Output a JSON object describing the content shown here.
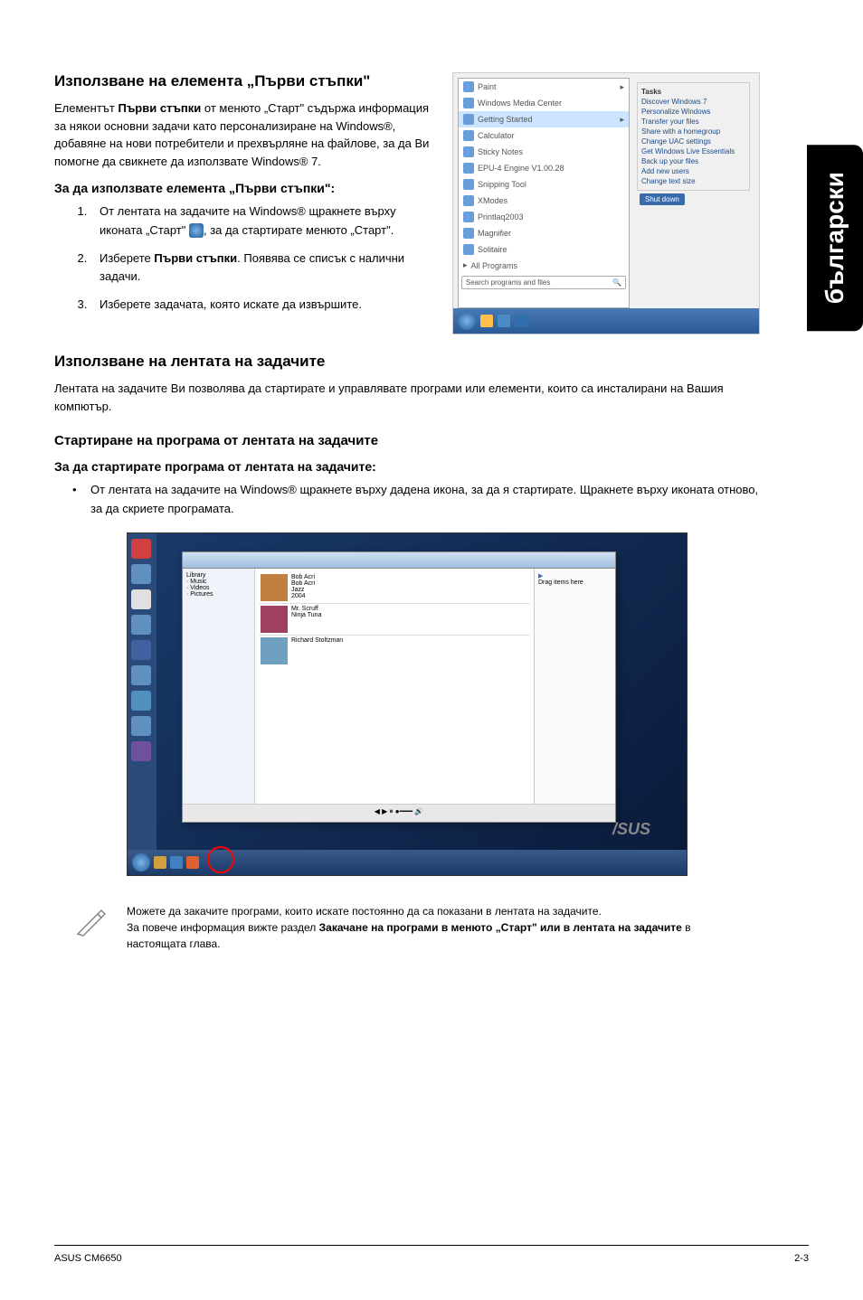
{
  "sideTab": "български",
  "section1": {
    "heading": "Използване на елемента „Първи стъпки\"",
    "intro": "Елементът Първи стъпки от менюто „Старт\" съдържа информация за някои основни задачи като персонализиране на Windows®, добавяне на нови потребители и прехвърляне на файлове, за да Ви помогне да свикнете да използвате Windows® 7.",
    "introBoldPart": "Първи стъпки",
    "subheading": "За да използвате елемента „Първи стъпки\":",
    "steps": {
      "1": "От лентата на задачите на Windows® щракнете върху иконата „Старт\" ",
      "1b": ", за да стартирате менюто „Старт\".",
      "2a": "Изберете ",
      "2bold": "Първи стъпки",
      "2b": ". Появява се списък с налични задачи.",
      "3": "Изберете задачата, която искате да извършите."
    }
  },
  "startMenu": {
    "items": [
      "Paint",
      "Windows Media Center",
      "Getting Started",
      "Calculator",
      "Sticky Notes",
      "EPU-4 Engine V1.00.28",
      "Snipping Tool",
      "XModes",
      "Printlaq2003",
      "Magnifier",
      "Solitaire",
      "All Programs"
    ],
    "search": "Search programs and files",
    "shutdown": "Shut down",
    "tasksTitle": "Tasks",
    "tasks": [
      "Discover Windows 7",
      "Personalize Windows",
      "Transfer your files",
      "Share with a homegroup",
      "Change UAC settings",
      "Get Windows Live Essentials",
      "Back up your files",
      "Add new users",
      "Change text size"
    ]
  },
  "section2": {
    "heading": "Използване на лентата на задачите",
    "intro": "Лентата на задачите Ви позволява да стартирате и управлявате програми или елементи, които са инсталирани на Вашия компютър.",
    "sub1": "Стартиране на програма от лентата на задачите",
    "sub2": "За да стартирате програма от лентата на задачите:",
    "bullet": "От лентата на задачите на Windows® щракнете върху дадена икона, за да я стартирате. Щракнете върху иконата отново, за да скриете програмата."
  },
  "note": {
    "line1": "Можете да закачите програми, които искате постоянно да са показани в лентата на задачите.",
    "line2a": "За повече информация вижте раздел ",
    "line2bold": "Закачане на програми в менюто „Старт\" или в лентата на задачите",
    "line2b": " в настоящата глава."
  },
  "footer": {
    "left": "ASUS CM6650",
    "right": "2-3"
  },
  "asusLogo": "/SUS"
}
